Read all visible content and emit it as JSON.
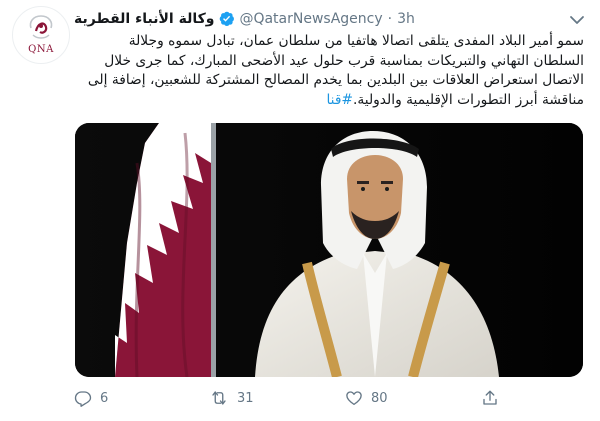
{
  "tweet": {
    "author_name": "وكالة الأنباء القطرية",
    "handle": "@QatarNewsAgency",
    "separator": "·",
    "time": "3h",
    "avatar_label": "QNA",
    "text": "سمو أمير البلاد المفدى يتلقى اتصالا هاتفيا من سلطان عمان، تبادل سموه وجلالة السلطان التهاني والتبريكات بمناسبة قرب حلول عيد الأضحى المبارك، كما جرى خلال الاتصال استعراض العلاقات بين البلدين بما يخدم المصالح المشتركة للشعبين، إضافة إلى مناقشة أبرز التطورات الإقليمية والدولية.",
    "hashtag": "#قنا",
    "verified": true
  },
  "actions": {
    "reply_count": "6",
    "retweet_count": "31",
    "like_count": "80"
  },
  "icons": {
    "verified": "verified-badge-icon",
    "more": "chevron-down-icon",
    "reply": "reply-icon",
    "retweet": "retweet-icon",
    "like": "heart-icon",
    "share": "share-icon"
  },
  "colors": {
    "accent": "#1da1f2",
    "hashtag": "#1b95e0",
    "secondary_text": "#657786",
    "flag_maroon": "#8a1538"
  }
}
